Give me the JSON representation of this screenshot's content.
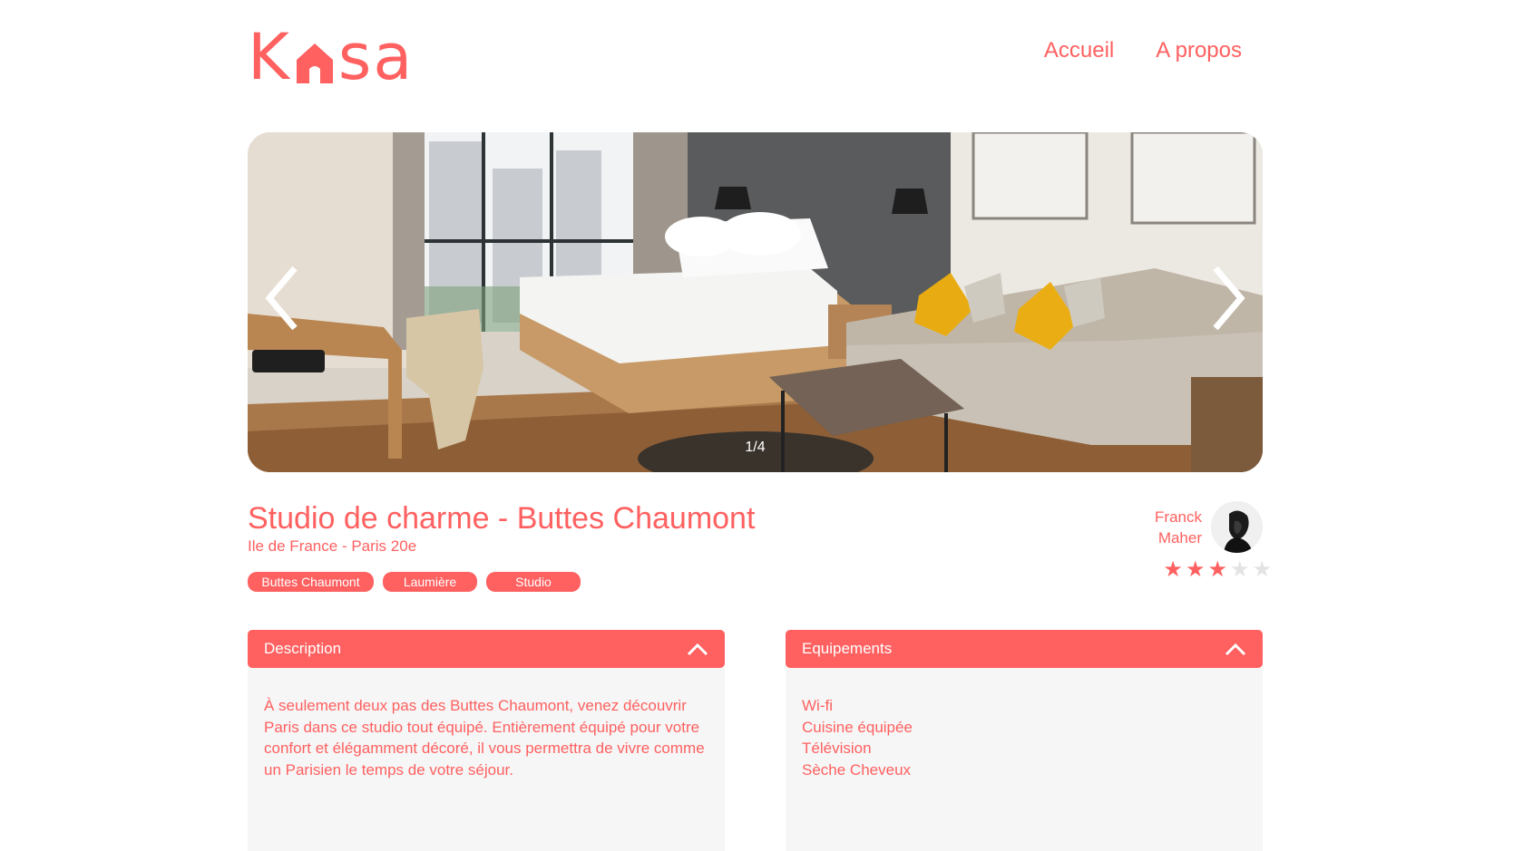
{
  "brand": {
    "logo_left": "K",
    "logo_right": "sa",
    "accent_color": "#FF6060"
  },
  "nav": {
    "home": "Accueil",
    "about": "A propos"
  },
  "gallery": {
    "counter": "1/4",
    "prev_icon": "chevron-left-icon",
    "next_icon": "chevron-right-icon"
  },
  "listing": {
    "title": "Studio de charme - Buttes Chaumont",
    "location": "Ile de France - Paris 20e",
    "tags": [
      "Buttes Chaumont",
      "Laumière",
      "Studio"
    ]
  },
  "host": {
    "first_name": "Franck",
    "last_name": "Maher",
    "rating": 3,
    "rating_max": 5
  },
  "description": {
    "title": "Description",
    "text": "À seulement deux pas des Buttes Chaumont, venez découvrir Paris dans ce studio tout équipé. Entièrement équipé pour votre confort et élégamment décoré, il vous permettra de vivre comme un Parisien le temps de votre séjour."
  },
  "equipments": {
    "title": "Equipements",
    "items": [
      "Wi-fi",
      "Cuisine équipée",
      "Télévision",
      "Sèche Cheveux"
    ]
  }
}
